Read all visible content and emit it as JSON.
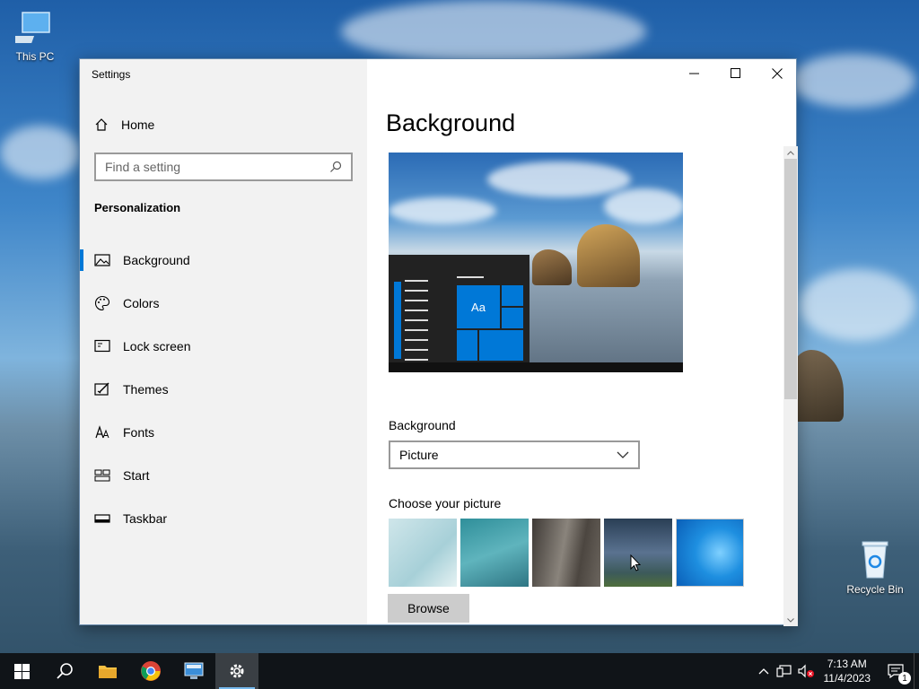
{
  "desktop": {
    "icons": [
      {
        "label": "This PC"
      },
      {
        "label": "Recycle Bin"
      }
    ]
  },
  "window": {
    "title": "Settings",
    "controls": [
      "minimize-icon",
      "maximize-icon",
      "close-icon"
    ]
  },
  "sidebar": {
    "home_label": "Home",
    "search_placeholder": "Find a setting",
    "section_title": "Personalization",
    "items": [
      {
        "label": "Background",
        "icon": "picture-icon",
        "active": true
      },
      {
        "label": "Colors",
        "icon": "palette-icon",
        "active": false
      },
      {
        "label": "Lock screen",
        "icon": "lock-screen-icon",
        "active": false
      },
      {
        "label": "Themes",
        "icon": "themes-icon",
        "active": false
      },
      {
        "label": "Fonts",
        "icon": "fonts-icon",
        "active": false
      },
      {
        "label": "Start",
        "icon": "start-icon",
        "active": false
      },
      {
        "label": "Taskbar",
        "icon": "taskbar-icon",
        "active": false
      }
    ]
  },
  "main": {
    "page_title": "Background",
    "preview_tile_text": "Aa",
    "background_label": "Background",
    "background_value": "Picture",
    "choose_label": "Choose your picture",
    "browse_label": "Browse"
  },
  "taskbar": {
    "apps": [
      "start-icon",
      "search-icon",
      "file-explorer-icon",
      "chrome-icon",
      "remote-desktop-icon",
      "settings-icon"
    ],
    "time": "7:13 AM",
    "date": "11/4/2023",
    "notification_count": "1"
  },
  "colors": {
    "accent": "#0078d7",
    "sidebar_bg": "#f2f2f2",
    "taskbar_bg": "#101418"
  }
}
